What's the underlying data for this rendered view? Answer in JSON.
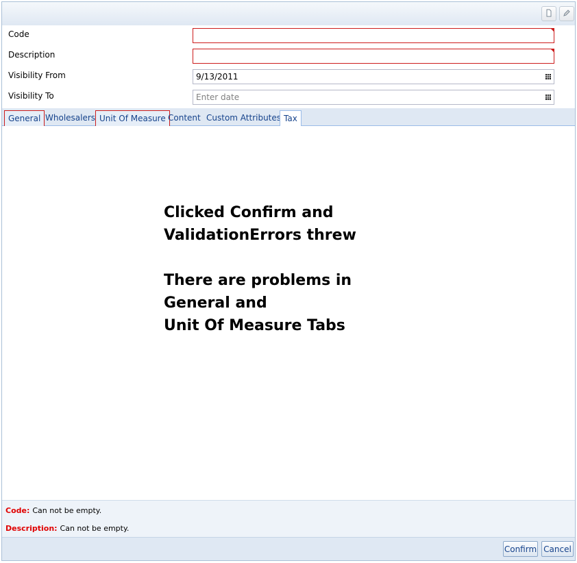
{
  "toolbar": {
    "icons": [
      "new-document-icon",
      "edit-pencil-icon"
    ]
  },
  "form": {
    "code": {
      "label": "Code",
      "value": "",
      "required": true
    },
    "description": {
      "label": "Description",
      "value": "",
      "required": true
    },
    "visibility_from": {
      "label": "Visibility From",
      "value": "9/13/2011"
    },
    "visibility_to": {
      "label": "Visibility To",
      "value": "",
      "placeholder": "Enter date"
    }
  },
  "tabs": [
    {
      "label": "General",
      "state": "error"
    },
    {
      "label": "Wholesalers",
      "state": "normal"
    },
    {
      "label": "Unit Of Measure",
      "state": "error"
    },
    {
      "label": "Content",
      "state": "normal"
    },
    {
      "label": "Custom Attributes",
      "state": "normal"
    },
    {
      "label": "Tax",
      "state": "active"
    }
  ],
  "annotation": {
    "line1": "Clicked Confirm and",
    "line2": "ValidationErrors threw",
    "line3": "There are problems in",
    "line4": "General and",
    "line5": "Unit Of Measure Tabs"
  },
  "errors": [
    {
      "field": "Code:",
      "message": "Can not be empty."
    },
    {
      "field": "Description:",
      "message": "Can not be empty."
    }
  ],
  "footer": {
    "confirm_label": "Confirm",
    "cancel_label": "Cancel"
  },
  "colors": {
    "error_red": "#cc1b1b",
    "tab_text": "#15428b",
    "header_bg": "#dfe8f3"
  }
}
